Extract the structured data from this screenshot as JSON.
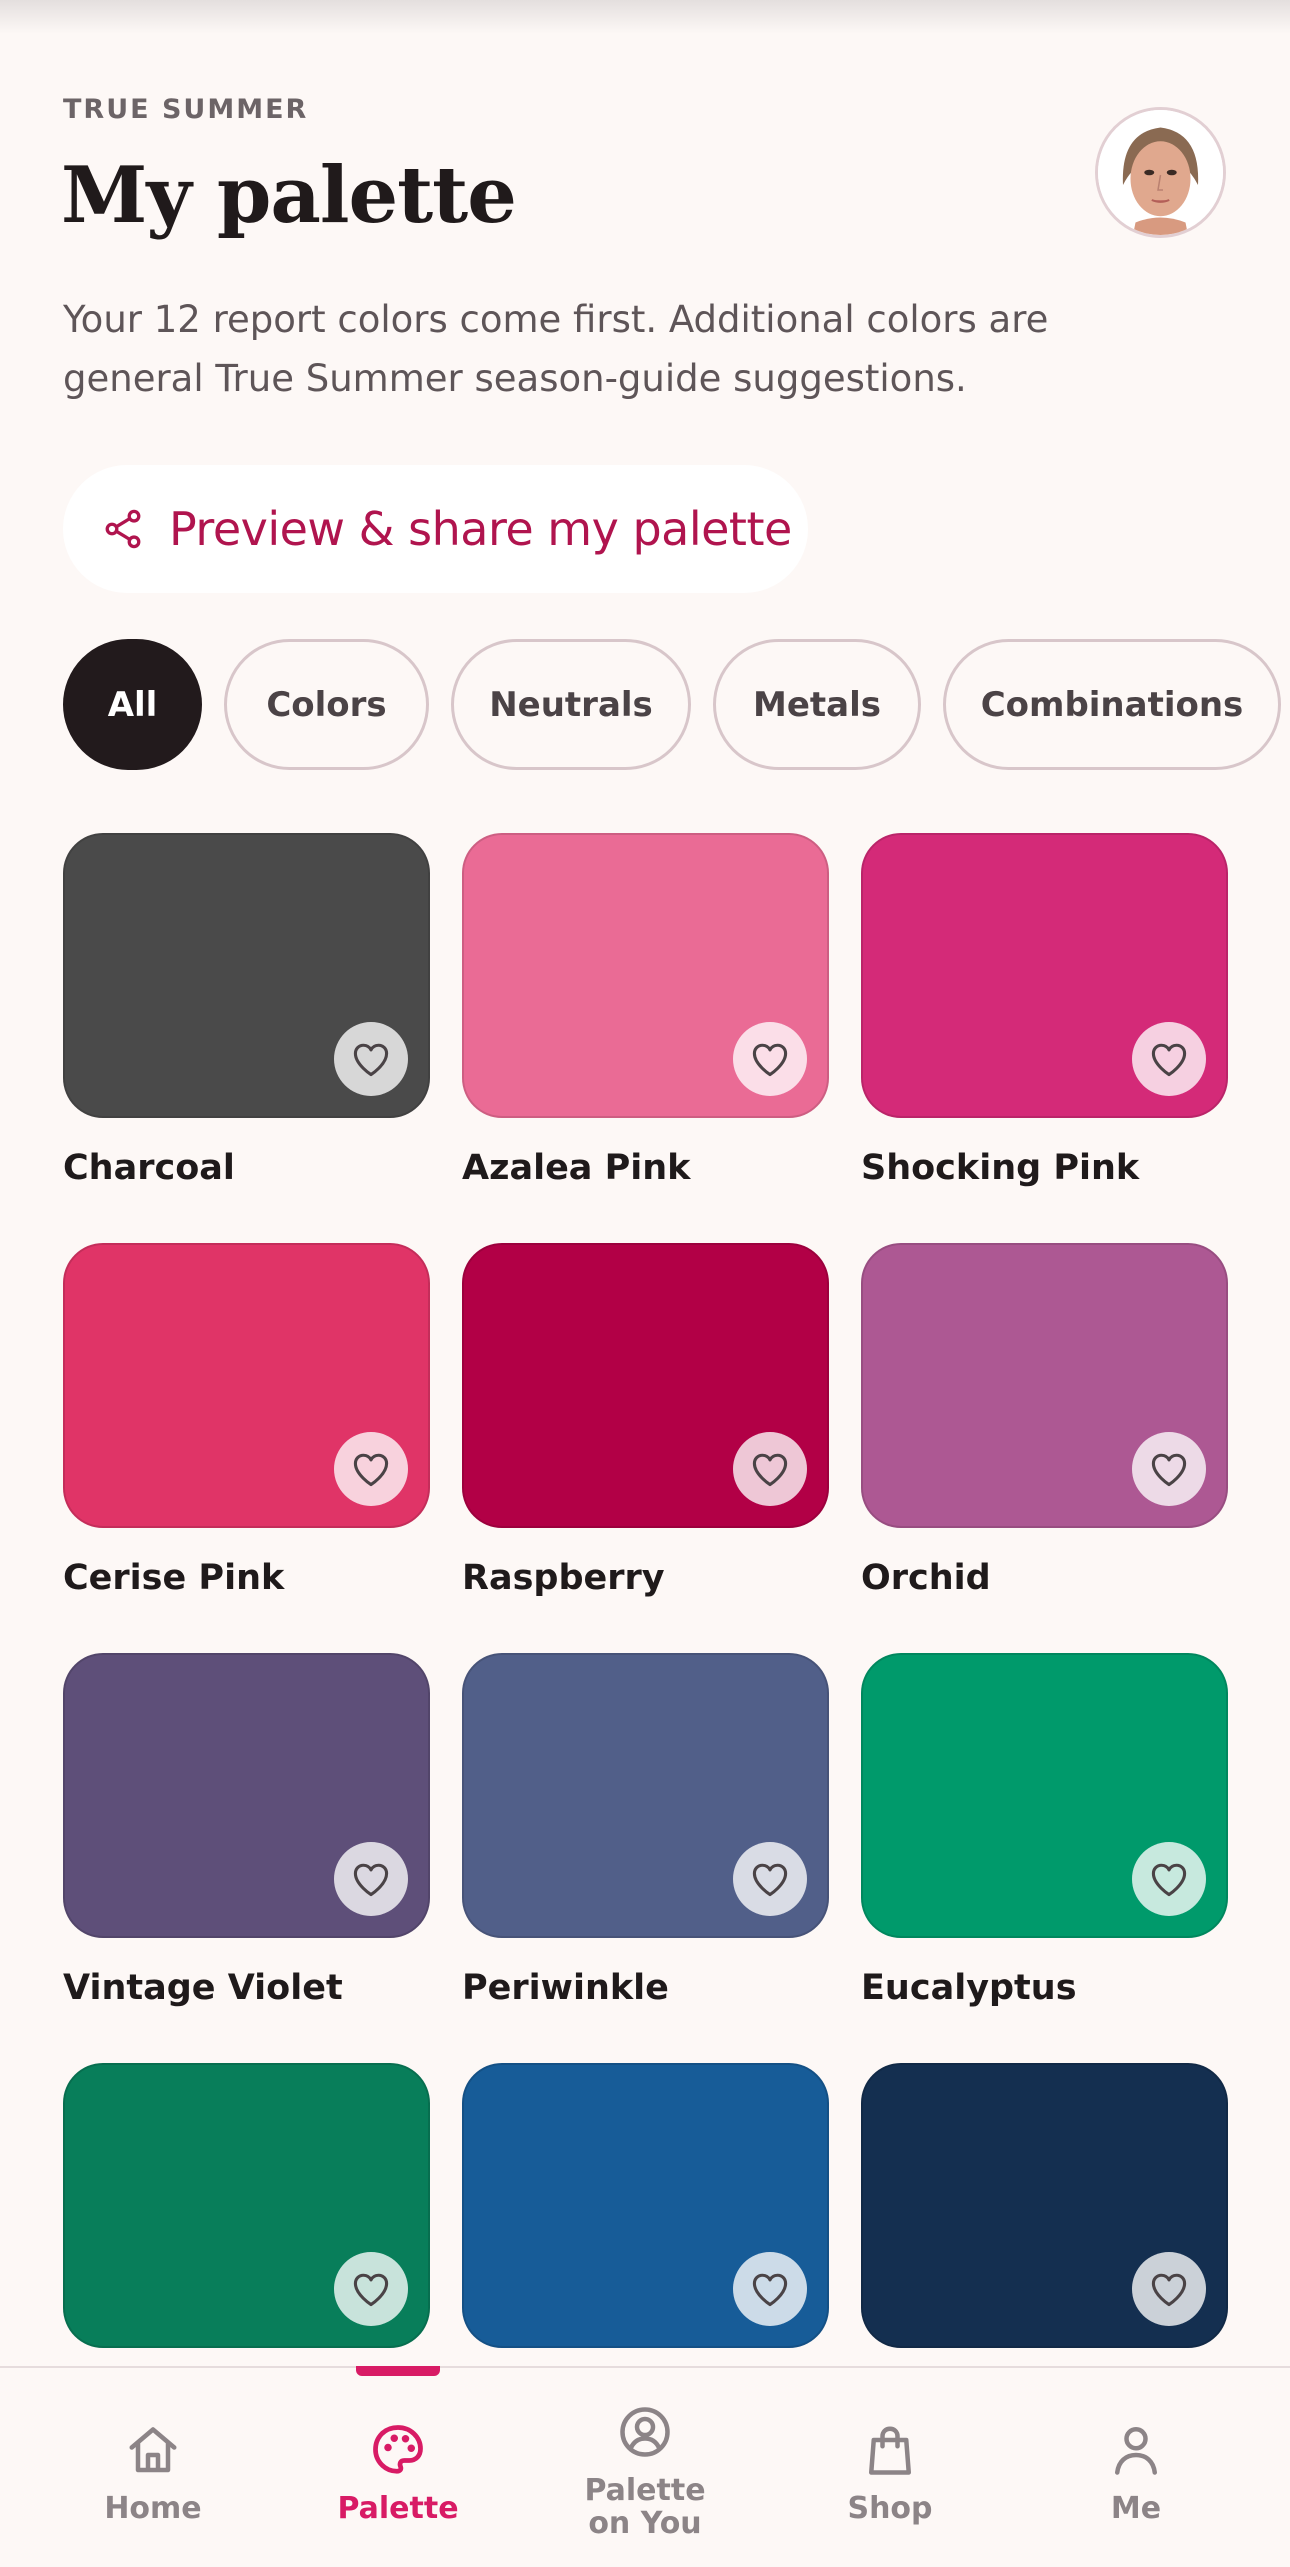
{
  "header": {
    "eyebrow": "TRUE SUMMER",
    "title": "My palette",
    "subtitle": "Your 12 report colors come first. Additional colors are general True Summer season-guide suggestions."
  },
  "share": {
    "label": "Preview & share my palette",
    "icon": "share-icon"
  },
  "filters": [
    {
      "label": "All",
      "active": true
    },
    {
      "label": "Colors",
      "active": false
    },
    {
      "label": "Neutrals",
      "active": false
    },
    {
      "label": "Metals",
      "active": false
    },
    {
      "label": "Combinations",
      "active": false
    }
  ],
  "colors": [
    {
      "name": "Charcoal",
      "hex": "#4a4a4a"
    },
    {
      "name": "Azalea Pink",
      "hex": "#ea6b95"
    },
    {
      "name": "Shocking Pink",
      "hex": "#d42a78"
    },
    {
      "name": "Cerise Pink",
      "hex": "#e03467"
    },
    {
      "name": "Raspberry",
      "hex": "#b20046"
    },
    {
      "name": "Orchid",
      "hex": "#ad5893"
    },
    {
      "name": "Vintage Violet",
      "hex": "#5e4f79"
    },
    {
      "name": "Periwinkle",
      "hex": "#515f89"
    },
    {
      "name": "Eucalyptus",
      "hex": "#009a6b"
    },
    {
      "name": "",
      "hex": "#087e5a"
    },
    {
      "name": "",
      "hex": "#175c98"
    },
    {
      "name": "",
      "hex": "#142f50"
    }
  ],
  "nav": {
    "items": [
      {
        "label": "Home",
        "icon": "home-icon",
        "active": false
      },
      {
        "label": "Palette",
        "icon": "palette-icon",
        "active": true
      },
      {
        "label_line1": "Palette",
        "label_line2": "on You",
        "icon": "person-circle-icon",
        "active": false
      },
      {
        "label": "Shop",
        "icon": "shopping-bag-icon",
        "active": false
      },
      {
        "label": "Me",
        "icon": "user-icon",
        "active": false
      }
    ]
  },
  "theme": {
    "accent": "#d81b65",
    "share_text": "#b0144e",
    "background": "#fdf8f6"
  }
}
